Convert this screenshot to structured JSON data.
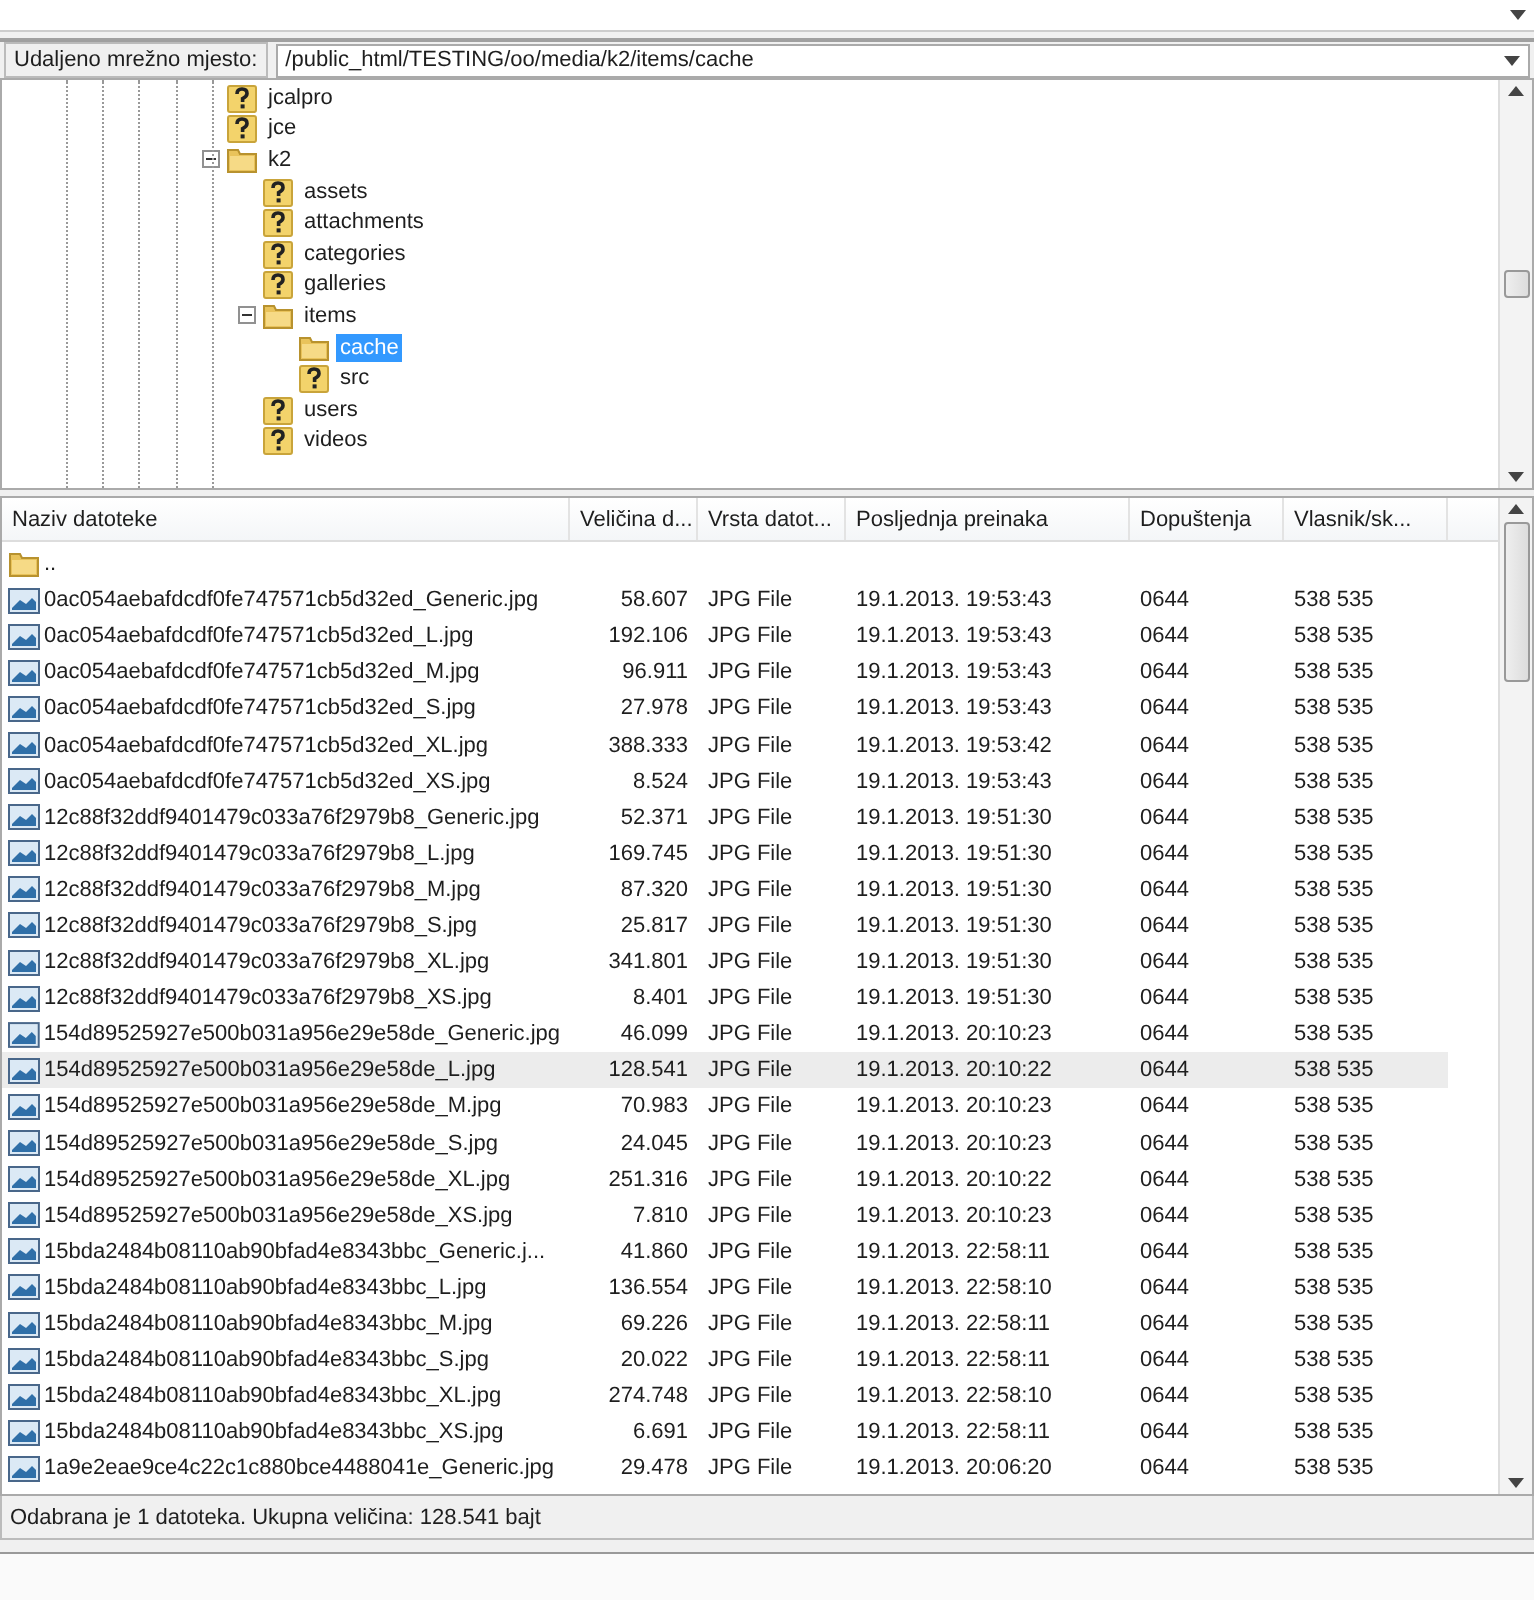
{
  "remote_site": {
    "label": "Udaljeno mrežno mjesto:",
    "value": "/public_html/TESTING/oo/media/k2/items/cache"
  },
  "tree": [
    {
      "label": "jcalpro",
      "kind": "unknown",
      "selected": false
    },
    {
      "label": "jce",
      "kind": "unknown",
      "selected": false
    },
    {
      "label": "k2",
      "kind": "folder",
      "selected": false,
      "expanded": true,
      "children": [
        {
          "label": "assets",
          "kind": "unknown",
          "selected": false
        },
        {
          "label": "attachments",
          "kind": "unknown",
          "selected": false
        },
        {
          "label": "categories",
          "kind": "unknown",
          "selected": false
        },
        {
          "label": "galleries",
          "kind": "unknown",
          "selected": false
        },
        {
          "label": "items",
          "kind": "folder",
          "selected": false,
          "expanded": true,
          "children": [
            {
              "label": "cache",
              "kind": "folder",
              "selected": true
            },
            {
              "label": "src",
              "kind": "unknown",
              "selected": false
            }
          ]
        },
        {
          "label": "users",
          "kind": "unknown",
          "selected": false
        },
        {
          "label": "videos",
          "kind": "unknown",
          "selected": false
        }
      ]
    }
  ],
  "file_list": {
    "columns": [
      "Naziv datoteke",
      "Veličina d...",
      "Vrsta datot...",
      "Posljednja preinaka",
      "Dopuštenja",
      "Vlasnik/sk..."
    ],
    "rows": [
      {
        "kind": "folder",
        "name": "..",
        "selected": false
      },
      {
        "kind": "image",
        "name": "0ac054aebafdcdf0fe747571cb5d32ed_Generic.jpg",
        "size": "58.607",
        "type": "JPG File",
        "modified": "19.1.2013. 19:53:43",
        "permissions": "0644",
        "owner": "538 535",
        "selected": false
      },
      {
        "kind": "image",
        "name": "0ac054aebafdcdf0fe747571cb5d32ed_L.jpg",
        "size": "192.106",
        "type": "JPG File",
        "modified": "19.1.2013. 19:53:43",
        "permissions": "0644",
        "owner": "538 535",
        "selected": false
      },
      {
        "kind": "image",
        "name": "0ac054aebafdcdf0fe747571cb5d32ed_M.jpg",
        "size": "96.911",
        "type": "JPG File",
        "modified": "19.1.2013. 19:53:43",
        "permissions": "0644",
        "owner": "538 535",
        "selected": false
      },
      {
        "kind": "image",
        "name": "0ac054aebafdcdf0fe747571cb5d32ed_S.jpg",
        "size": "27.978",
        "type": "JPG File",
        "modified": "19.1.2013. 19:53:43",
        "permissions": "0644",
        "owner": "538 535",
        "selected": false
      },
      {
        "kind": "image",
        "name": "0ac054aebafdcdf0fe747571cb5d32ed_XL.jpg",
        "size": "388.333",
        "type": "JPG File",
        "modified": "19.1.2013. 19:53:42",
        "permissions": "0644",
        "owner": "538 535",
        "selected": false
      },
      {
        "kind": "image",
        "name": "0ac054aebafdcdf0fe747571cb5d32ed_XS.jpg",
        "size": "8.524",
        "type": "JPG File",
        "modified": "19.1.2013. 19:53:43",
        "permissions": "0644",
        "owner": "538 535",
        "selected": false
      },
      {
        "kind": "image",
        "name": "12c88f32ddf9401479c033a76f2979b8_Generic.jpg",
        "size": "52.371",
        "type": "JPG File",
        "modified": "19.1.2013. 19:51:30",
        "permissions": "0644",
        "owner": "538 535",
        "selected": false
      },
      {
        "kind": "image",
        "name": "12c88f32ddf9401479c033a76f2979b8_L.jpg",
        "size": "169.745",
        "type": "JPG File",
        "modified": "19.1.2013. 19:51:30",
        "permissions": "0644",
        "owner": "538 535",
        "selected": false
      },
      {
        "kind": "image",
        "name": "12c88f32ddf9401479c033a76f2979b8_M.jpg",
        "size": "87.320",
        "type": "JPG File",
        "modified": "19.1.2013. 19:51:30",
        "permissions": "0644",
        "owner": "538 535",
        "selected": false
      },
      {
        "kind": "image",
        "name": "12c88f32ddf9401479c033a76f2979b8_S.jpg",
        "size": "25.817",
        "type": "JPG File",
        "modified": "19.1.2013. 19:51:30",
        "permissions": "0644",
        "owner": "538 535",
        "selected": false
      },
      {
        "kind": "image",
        "name": "12c88f32ddf9401479c033a76f2979b8_XL.jpg",
        "size": "341.801",
        "type": "JPG File",
        "modified": "19.1.2013. 19:51:30",
        "permissions": "0644",
        "owner": "538 535",
        "selected": false
      },
      {
        "kind": "image",
        "name": "12c88f32ddf9401479c033a76f2979b8_XS.jpg",
        "size": "8.401",
        "type": "JPG File",
        "modified": "19.1.2013. 19:51:30",
        "permissions": "0644",
        "owner": "538 535",
        "selected": false
      },
      {
        "kind": "image",
        "name": "154d89525927e500b031a956e29e58de_Generic.jpg",
        "size": "46.099",
        "type": "JPG File",
        "modified": "19.1.2013. 20:10:23",
        "permissions": "0644",
        "owner": "538 535",
        "selected": false
      },
      {
        "kind": "image",
        "name": "154d89525927e500b031a956e29e58de_L.jpg",
        "size": "128.541",
        "type": "JPG File",
        "modified": "19.1.2013. 20:10:22",
        "permissions": "0644",
        "owner": "538 535",
        "selected": true
      },
      {
        "kind": "image",
        "name": "154d89525927e500b031a956e29e58de_M.jpg",
        "size": "70.983",
        "type": "JPG File",
        "modified": "19.1.2013. 20:10:23",
        "permissions": "0644",
        "owner": "538 535",
        "selected": false
      },
      {
        "kind": "image",
        "name": "154d89525927e500b031a956e29e58de_S.jpg",
        "size": "24.045",
        "type": "JPG File",
        "modified": "19.1.2013. 20:10:23",
        "permissions": "0644",
        "owner": "538 535",
        "selected": false
      },
      {
        "kind": "image",
        "name": "154d89525927e500b031a956e29e58de_XL.jpg",
        "size": "251.316",
        "type": "JPG File",
        "modified": "19.1.2013. 20:10:22",
        "permissions": "0644",
        "owner": "538 535",
        "selected": false
      },
      {
        "kind": "image",
        "name": "154d89525927e500b031a956e29e58de_XS.jpg",
        "size": "7.810",
        "type": "JPG File",
        "modified": "19.1.2013. 20:10:23",
        "permissions": "0644",
        "owner": "538 535",
        "selected": false
      },
      {
        "kind": "image",
        "name": "15bda2484b08110ab90bfad4e8343bbc_Generic.j...",
        "size": "41.860",
        "type": "JPG File",
        "modified": "19.1.2013. 22:58:11",
        "permissions": "0644",
        "owner": "538 535",
        "selected": false
      },
      {
        "kind": "image",
        "name": "15bda2484b08110ab90bfad4e8343bbc_L.jpg",
        "size": "136.554",
        "type": "JPG File",
        "modified": "19.1.2013. 22:58:10",
        "permissions": "0644",
        "owner": "538 535",
        "selected": false
      },
      {
        "kind": "image",
        "name": "15bda2484b08110ab90bfad4e8343bbc_M.jpg",
        "size": "69.226",
        "type": "JPG File",
        "modified": "19.1.2013. 22:58:11",
        "permissions": "0644",
        "owner": "538 535",
        "selected": false
      },
      {
        "kind": "image",
        "name": "15bda2484b08110ab90bfad4e8343bbc_S.jpg",
        "size": "20.022",
        "type": "JPG File",
        "modified": "19.1.2013. 22:58:11",
        "permissions": "0644",
        "owner": "538 535",
        "selected": false
      },
      {
        "kind": "image",
        "name": "15bda2484b08110ab90bfad4e8343bbc_XL.jpg",
        "size": "274.748",
        "type": "JPG File",
        "modified": "19.1.2013. 22:58:10",
        "permissions": "0644",
        "owner": "538 535",
        "selected": false
      },
      {
        "kind": "image",
        "name": "15bda2484b08110ab90bfad4e8343bbc_XS.jpg",
        "size": "6.691",
        "type": "JPG File",
        "modified": "19.1.2013. 22:58:11",
        "permissions": "0644",
        "owner": "538 535",
        "selected": false
      },
      {
        "kind": "image",
        "name": "1a9e2eae9ce4c22c1c880bce4488041e_Generic.jpg",
        "size": "29.478",
        "type": "JPG File",
        "modified": "19.1.2013. 20:06:20",
        "permissions": "0644",
        "owner": "538 535",
        "selected": false
      }
    ]
  },
  "status_bar": "Odabrana je 1 datoteka. Ukupna veličina: 128.541 bajt"
}
